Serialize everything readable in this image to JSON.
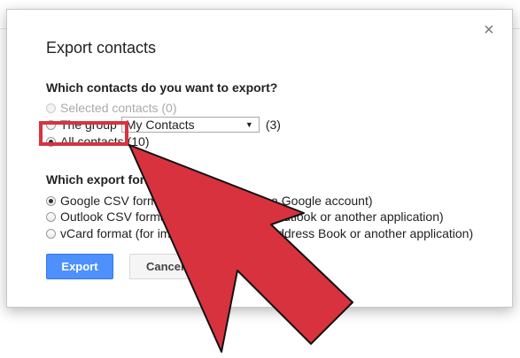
{
  "dialog": {
    "title": "Export contacts",
    "close_label": "×"
  },
  "contacts_section": {
    "question": "Which contacts do you want to export?",
    "options": [
      {
        "label": "Selected contacts (0)",
        "state": "disabled"
      },
      {
        "label": "The group",
        "group_value": "My Contacts",
        "count": "(3)",
        "state": "unchecked"
      },
      {
        "label": "All contacts",
        "count": "(10)",
        "state": "checked"
      }
    ]
  },
  "format_section": {
    "question": "Which export format?",
    "options": [
      {
        "label": "Google CSV format (for importing into a Google account)",
        "state": "checked"
      },
      {
        "label": "Outlook CSV format (for importing into Outlook or another application)",
        "state": "unchecked"
      },
      {
        "label": "vCard format (for importing into Apple Address Book or another application)",
        "state": "unchecked"
      }
    ]
  },
  "buttons": {
    "export": "Export",
    "cancel": "Cancel"
  },
  "annotation": {
    "highlight_color": "#d8323f",
    "arrow_color": "#d8323f",
    "arrow_outline_color": "#000000"
  }
}
